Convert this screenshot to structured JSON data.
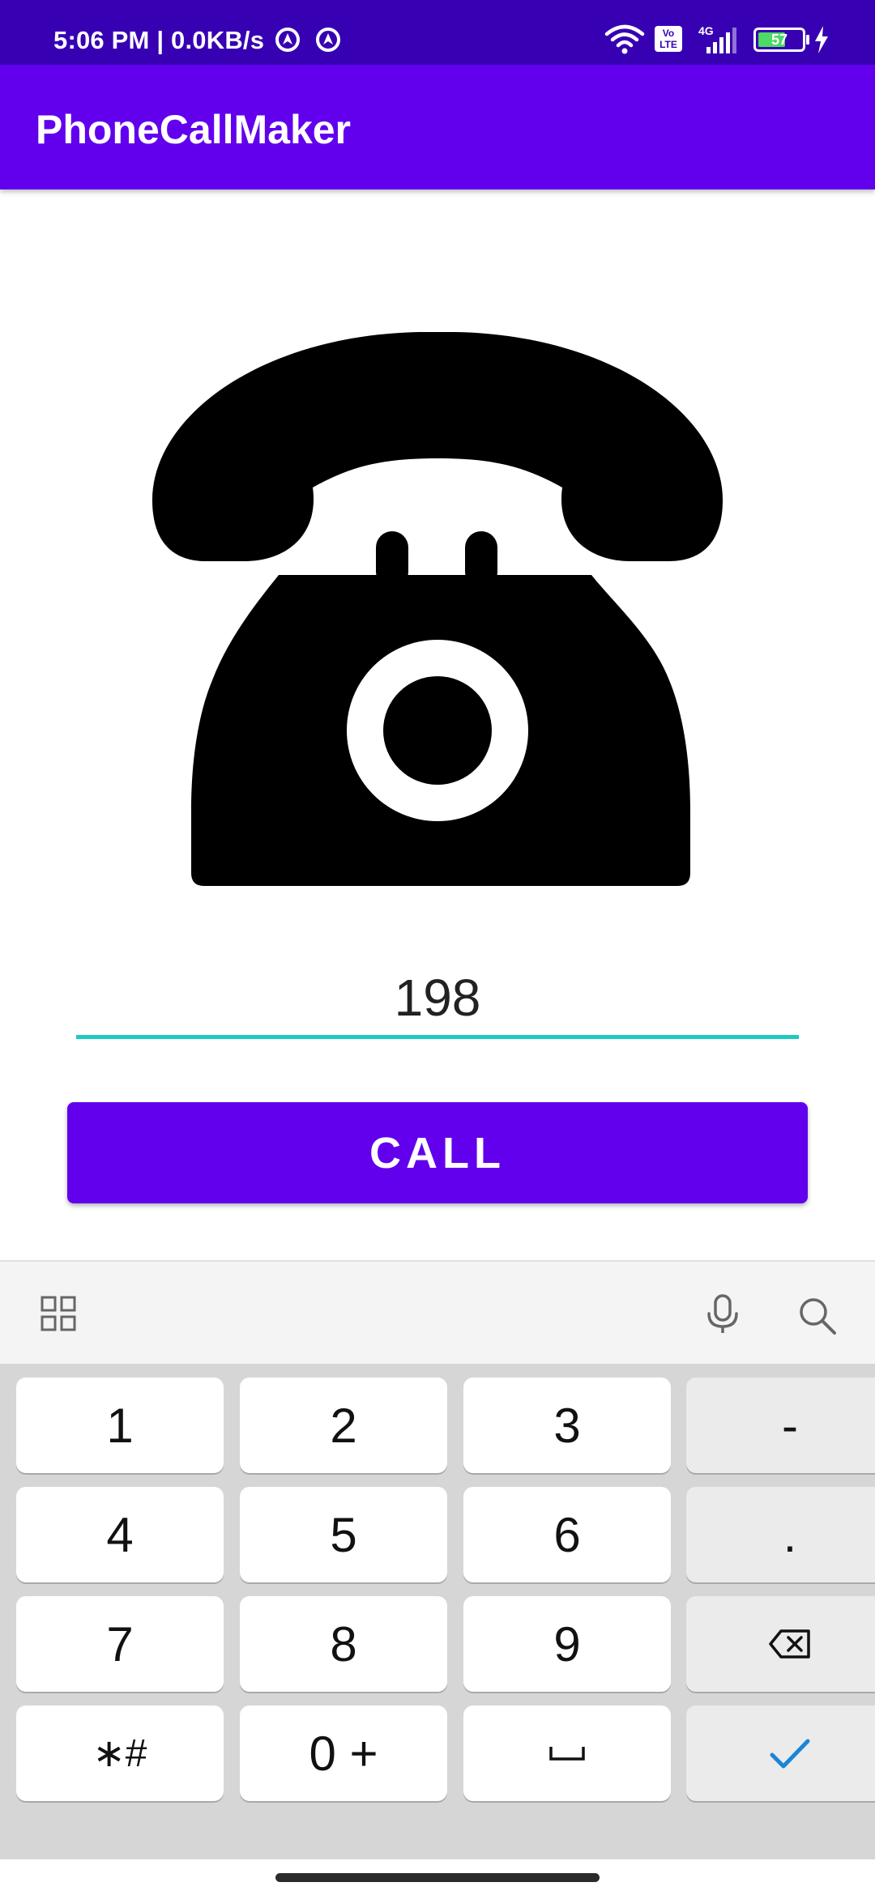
{
  "status_bar": {
    "time": "5:06 PM | 0.0KB/s",
    "network": "4G",
    "volte": "Vo LTE",
    "battery": "57",
    "icons": [
      "vpn-icon",
      "sync-icon",
      "wifi-icon",
      "volte-icon",
      "signal-icon",
      "battery-icon",
      "charging-icon"
    ]
  },
  "app_bar": {
    "title": "PhoneCallMaker"
  },
  "main": {
    "image": "telephone-icon",
    "phone_number": "198",
    "call_label": "CALL"
  },
  "keyboard": {
    "toolbar_icons": [
      "grid-icon",
      "microphone-icon",
      "search-icon"
    ],
    "keys": {
      "k1": "1",
      "k2": "2",
      "k3": "3",
      "dash": "-",
      "k4": "4",
      "k5": "5",
      "k6": "6",
      "dot": ".",
      "k7": "7",
      "k8": "8",
      "k9": "9",
      "backspace": "backspace-icon",
      "symbols": "∗#",
      "zero": "0 +",
      "space": "space-icon",
      "done": "check-icon"
    },
    "accent": "#1a86d6"
  },
  "colors": {
    "status_bar": "#3700b3",
    "app_bar": "#6200ee",
    "button": "#6200ee",
    "underline": "#1ec9c0"
  }
}
